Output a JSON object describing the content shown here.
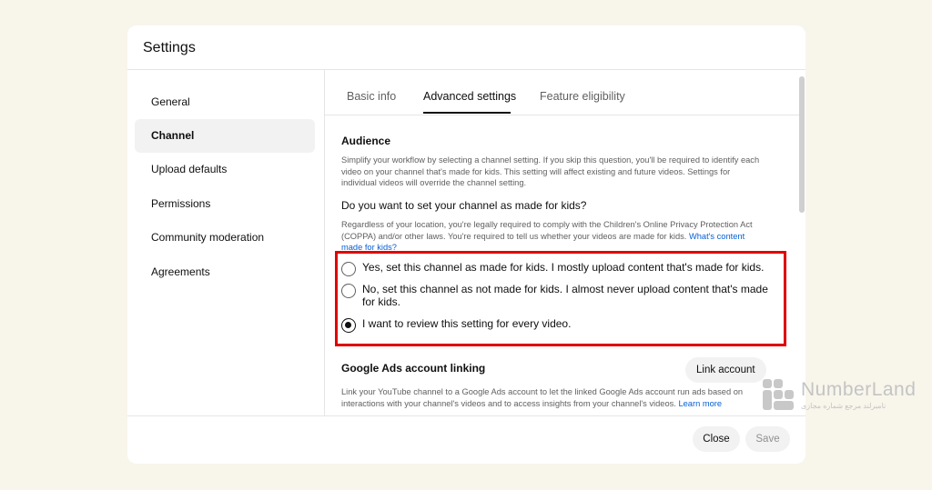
{
  "dialog": {
    "title": "Settings"
  },
  "sidebar": {
    "items": [
      {
        "label": "General"
      },
      {
        "label": "Channel"
      },
      {
        "label": "Upload defaults"
      },
      {
        "label": "Permissions"
      },
      {
        "label": "Community moderation"
      },
      {
        "label": "Agreements"
      }
    ],
    "active": "Channel"
  },
  "tabs": {
    "items": [
      {
        "label": "Basic info"
      },
      {
        "label": "Advanced settings"
      },
      {
        "label": "Feature eligibility"
      }
    ],
    "active": "Advanced settings"
  },
  "audience": {
    "title": "Audience",
    "description": "Simplify your workflow by selecting a channel setting. If you skip this question, you'll be required to identify each video on your channel that's made for kids. This setting will affect existing and future videos. Settings for individual videos will override the channel setting.",
    "question": "Do you want to set your channel as made for kids?",
    "coppa_text": "Regardless of your location, you're legally required to comply with the Children's Online Privacy Protection Act (COPPA) and/or other laws. You're required to tell us whether your videos are made for kids.",
    "coppa_link": "What's content made for kids?",
    "options": [
      {
        "label": "Yes, set this channel as made for kids. I mostly upload content that's made for kids.",
        "checked": false
      },
      {
        "label": "No, set this channel as not made for kids. I almost never upload content that's made for kids.",
        "checked": false
      },
      {
        "label": "I want to review this setting for every video.",
        "checked": true
      }
    ]
  },
  "google_ads": {
    "title": "Google Ads account linking",
    "button": "Link account",
    "description": "Link your YouTube channel to a Google Ads account to let the linked Google Ads account run ads based on interactions with your channel's videos and to access insights from your channel's videos.",
    "learn_more": "Learn more"
  },
  "footer": {
    "close": "Close",
    "save": "Save"
  },
  "watermark": {
    "brand": "NumberLand",
    "tagline": "نامبرلند مرجع شماره مجازی"
  },
  "colors": {
    "highlight_box": "#e00000",
    "link": "#065fd4"
  }
}
